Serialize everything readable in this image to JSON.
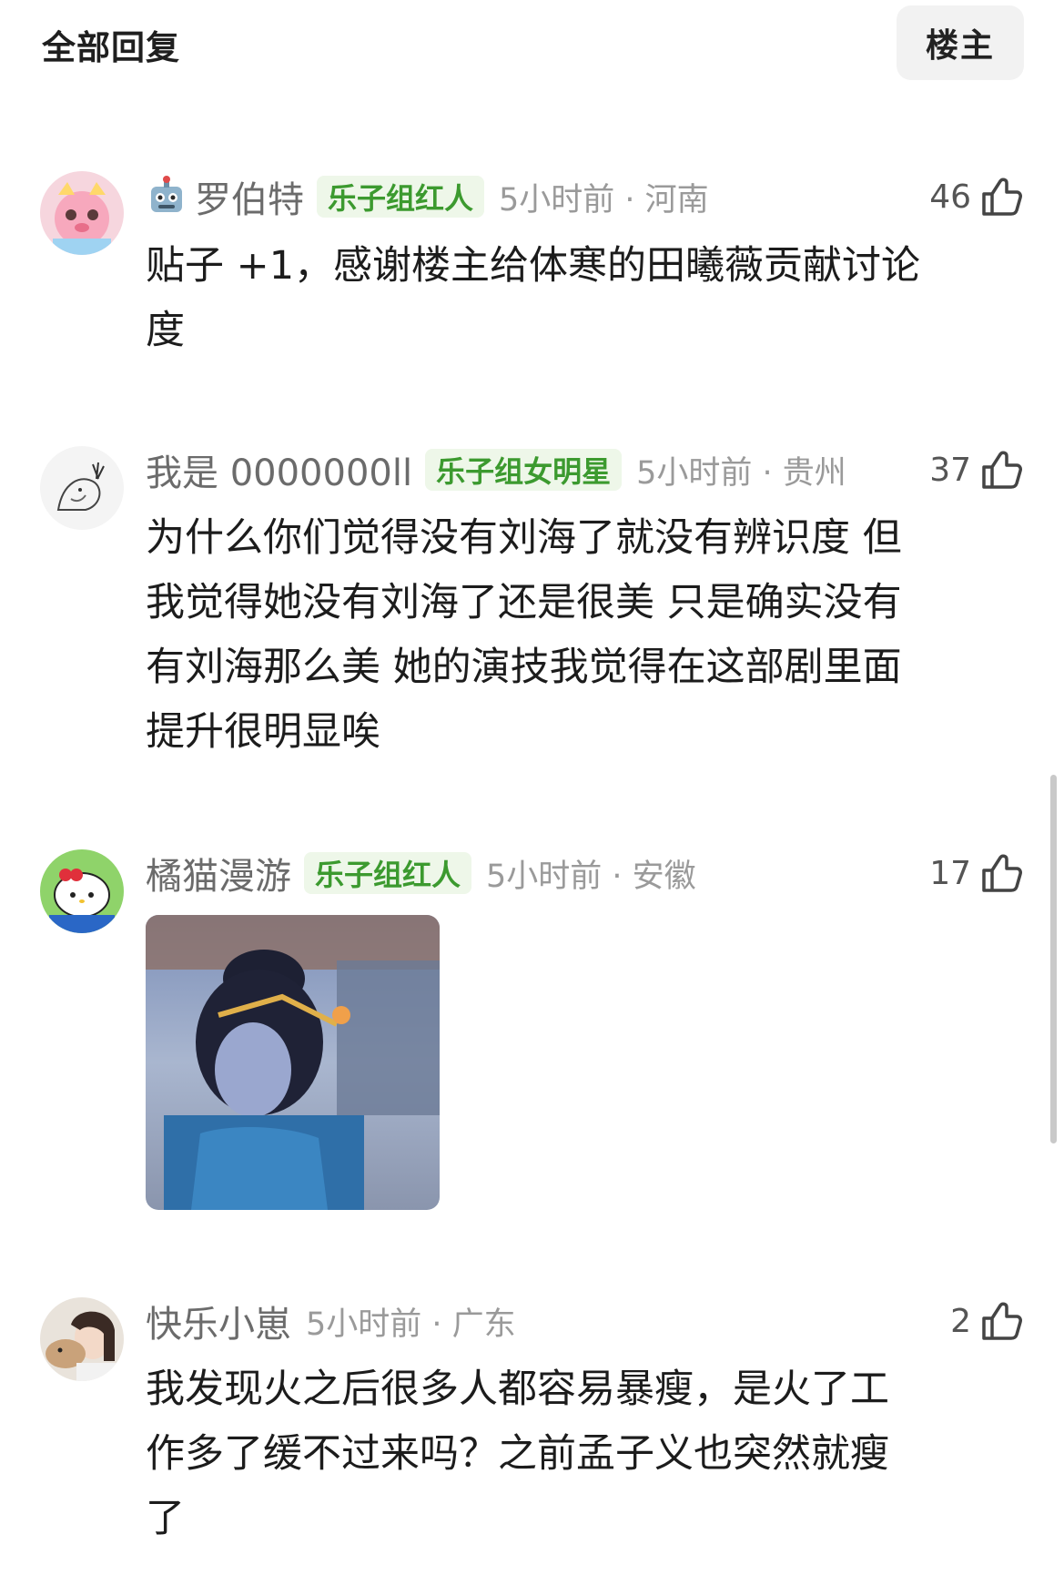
{
  "header": {
    "title": "全部回复",
    "op_filter_label": "楼主"
  },
  "replies": [
    {
      "username": "罗伯特",
      "username_icon": "robot-emoji-icon",
      "badge": "乐子组红人",
      "time_location": "5小时前 · 河南",
      "likes": "46",
      "text": "贴子 +1，感谢楼主给体寒的田曦薇贡献讨论\n度"
    },
    {
      "username": "我是 0000000ll",
      "badge": "乐子组女明星",
      "time_location": "5小时前 · 贵州",
      "likes": "37",
      "text": "为什么你们觉得没有刘海了就没有辨识度 但\n我觉得她没有刘海了还是很美 只是确实没有\n有刘海那么美 她的演技我觉得在这部剧里面\n提升很明显唉"
    },
    {
      "username": "橘猫漫游",
      "badge": "乐子组红人",
      "time_location": "5小时前 · 安徽",
      "likes": "17",
      "text": "",
      "image": "costume-drama-still-image"
    },
    {
      "username": "快乐小崽",
      "badge": "",
      "time_location": "5小时前 · 广东",
      "likes": "2",
      "text": "我发现火之后很多人都容易暴瘦，是火了工\n作多了缓不过来吗？之前孟子义也突然就瘦\n了"
    }
  ],
  "colors": {
    "badge_text": "#3c9a2f",
    "badge_bg": "#eef7e9",
    "meta_gray": "#9a9a9a",
    "username_gray": "#6b6b6b"
  }
}
